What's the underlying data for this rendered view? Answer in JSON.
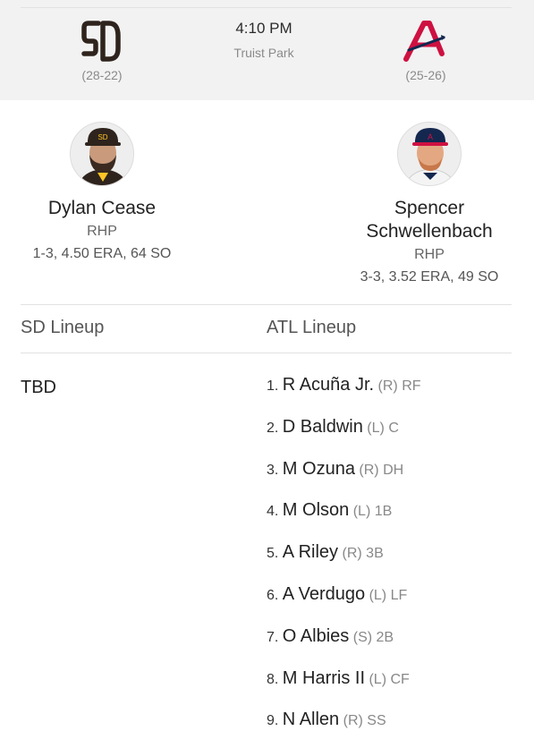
{
  "game": {
    "time": "4:10 PM",
    "venue": "Truist Park"
  },
  "teams": {
    "away": {
      "abbr": "SD",
      "record": "(28-22)",
      "logo_icon": "padres-sd-logo-icon",
      "color": "#2f241d",
      "accent": "#ffc425"
    },
    "home": {
      "abbr": "ATL",
      "record": "(25-26)",
      "logo_icon": "braves-a-logo-icon",
      "color": "#ce1141",
      "accent": "#13274f"
    }
  },
  "pitchers": {
    "away": {
      "name": "Dylan Cease",
      "hand": "RHP",
      "stats": "1-3, 4.50 ERA, 64 SO"
    },
    "home": {
      "name": "Spencer Schwellenbach",
      "hand": "RHP",
      "stats": "3-3, 3.52 ERA, 49 SO"
    }
  },
  "lineups": {
    "away": {
      "title": "SD Lineup",
      "status": "TBD"
    },
    "home": {
      "title": "ATL Lineup",
      "players": [
        {
          "num": "1.",
          "name": "R Acuña Jr.",
          "bats": "(R)",
          "pos": "RF"
        },
        {
          "num": "2.",
          "name": "D Baldwin",
          "bats": "(L)",
          "pos": "C"
        },
        {
          "num": "3.",
          "name": "M Ozuna",
          "bats": "(R)",
          "pos": "DH"
        },
        {
          "num": "4.",
          "name": "M Olson",
          "bats": "(L)",
          "pos": "1B"
        },
        {
          "num": "5.",
          "name": "A Riley",
          "bats": "(R)",
          "pos": "3B"
        },
        {
          "num": "6.",
          "name": "A Verdugo",
          "bats": "(L)",
          "pos": "LF"
        },
        {
          "num": "7.",
          "name": "O Albies",
          "bats": "(S)",
          "pos": "2B"
        },
        {
          "num": "8.",
          "name": "M Harris II",
          "bats": "(L)",
          "pos": "CF"
        },
        {
          "num": "9.",
          "name": "N Allen",
          "bats": "(R)",
          "pos": "SS"
        }
      ]
    }
  }
}
